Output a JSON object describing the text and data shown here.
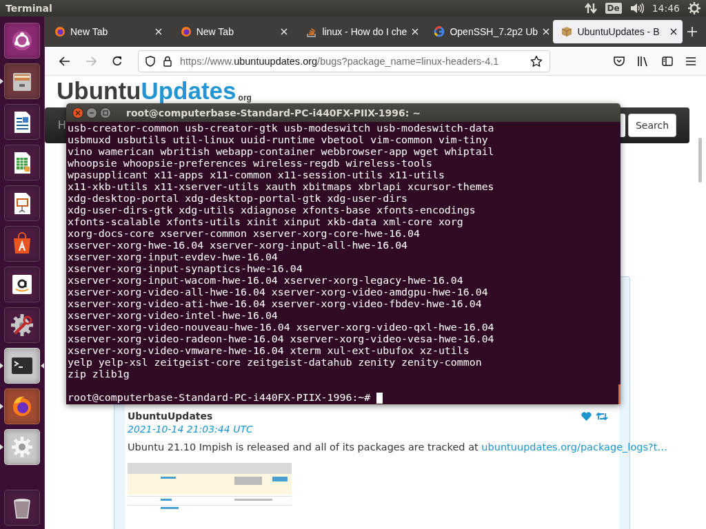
{
  "top_panel": {
    "app_name": "Terminal",
    "keyboard_layout": "De",
    "clock": "14:46"
  },
  "launcher": {
    "items": [
      {
        "kind": "dash",
        "running": false,
        "focused": false
      },
      {
        "kind": "files",
        "running": true,
        "focused": false
      },
      {
        "kind": "writer",
        "running": false,
        "focused": false
      },
      {
        "kind": "calc",
        "running": false,
        "focused": false
      },
      {
        "kind": "impress",
        "running": false,
        "focused": false
      },
      {
        "kind": "software",
        "running": false,
        "focused": false
      },
      {
        "kind": "amazon",
        "running": false,
        "focused": false
      },
      {
        "kind": "tools",
        "running": false,
        "focused": false
      },
      {
        "kind": "terminal",
        "running": true,
        "focused": true
      },
      {
        "kind": "firefox",
        "running": true,
        "focused": false
      },
      {
        "kind": "settings",
        "running": true,
        "focused": false
      },
      {
        "kind": "trash",
        "running": false,
        "focused": false
      }
    ]
  },
  "browser": {
    "tabs": [
      {
        "kind": "firefox",
        "label": "New Tab",
        "selected": false
      },
      {
        "kind": "firefox",
        "label": "New Tab",
        "selected": false
      },
      {
        "kind": "stack",
        "label": "linux - How do I che",
        "selected": false
      },
      {
        "kind": "google",
        "label": "OpenSSH_7.2p2 Ub",
        "selected": false
      },
      {
        "kind": "package",
        "label": "UbuntuUpdates - B",
        "selected": true
      }
    ],
    "forward_disabled": true,
    "url": "https://www.**ubuntuupdates.org**/bugs?package_name=linux-headers-4.1",
    "page": {
      "logo": {
        "main": "Ubuntu",
        "accent": "Updates",
        "suffix": "org"
      },
      "nav": {
        "home_fragment": "H",
        "search_button": "Search"
      },
      "post": {
        "author": "UbuntuUpdates",
        "timestamp": "2021-10-14 21:03:44 UTC",
        "text": "Ubuntu 21.10 Impish is released and all of its packages are tracked at ",
        "link": "ubuntuupdates.org/package_logs?t…"
      }
    }
  },
  "terminal": {
    "title": "root@computerbase-Standard-PC-i440FX-PIIX-1996: ~",
    "lines": [
      "usb-creator-common usb-creator-gtk usb-modeswitch usb-modeswitch-data",
      "usbmuxd usbutils util-linux uuid-runtime vbetool vim-common vim-tiny",
      "vino wamerican wbritish webapp-container webbrowser-app wget whiptail",
      "whoopsie whoopsie-preferences wireless-regdb wireless-tools",
      "wpasupplicant x11-apps x11-common x11-session-utils x11-utils",
      "x11-xkb-utils x11-xserver-utils xauth xbitmaps xbrlapi xcursor-themes",
      "xdg-desktop-portal xdg-desktop-portal-gtk xdg-user-dirs",
      "xdg-user-dirs-gtk xdg-utils xdiagnose xfonts-base xfonts-encodings",
      "xfonts-scalable xfonts-utils xinit xinput xkb-data xml-core xorg",
      "xorg-docs-core xserver-common xserver-xorg-core-hwe-16.04",
      "xserver-xorg-hwe-16.04 xserver-xorg-input-all-hwe-16.04",
      "xserver-xorg-input-evdev-hwe-16.04",
      "xserver-xorg-input-synaptics-hwe-16.04",
      "xserver-xorg-input-wacom-hwe-16.04 xserver-xorg-legacy-hwe-16.04",
      "xserver-xorg-video-all-hwe-16.04 xserver-xorg-video-amdgpu-hwe-16.04",
      "xserver-xorg-video-ati-hwe-16.04 xserver-xorg-video-fbdev-hwe-16.04",
      "xserver-xorg-video-intel-hwe-16.04",
      "xserver-xorg-video-nouveau-hwe-16.04 xserver-xorg-video-qxl-hwe-16.04",
      "xserver-xorg-video-radeon-hwe-16.04 xserver-xorg-video-vesa-hwe-16.04",
      "xserver-xorg-video-vmware-hwe-16.04 xterm xul-ext-ubufox xz-utils",
      "yelp yelp-xsl zeitgeist-core zeitgeist-datahub zenity zenity-common",
      "zip zlib1g"
    ],
    "prompt": "root@computerbase-Standard-PC-i440FX-PIIX-1996:~#"
  }
}
